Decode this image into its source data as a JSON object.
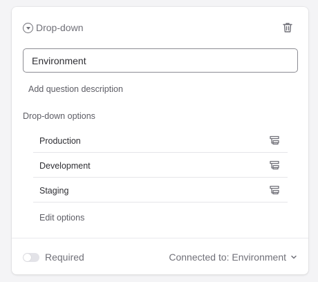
{
  "question": {
    "type_label": "Drop-down",
    "type_icon": "dropdown-circle-icon",
    "delete_icon": "trash-icon",
    "title_value": "Environment",
    "add_description_label": "Add question description"
  },
  "options_section": {
    "title": "Drop-down options",
    "items": [
      {
        "label": "Production",
        "icon": "branch-icon"
      },
      {
        "label": "Development",
        "icon": "branch-icon"
      },
      {
        "label": "Staging",
        "icon": "branch-icon"
      }
    ],
    "edit_label": "Edit options"
  },
  "footer": {
    "required_label": "Required",
    "required_on": false,
    "connected_label": "Connected to: Environment",
    "connected_icon": "chevron-down-icon"
  },
  "colors": {
    "text_primary": "#2e2e33",
    "text_secondary": "#707078",
    "border": "#8c8c93",
    "toggle_off": "#e3e3e8"
  }
}
